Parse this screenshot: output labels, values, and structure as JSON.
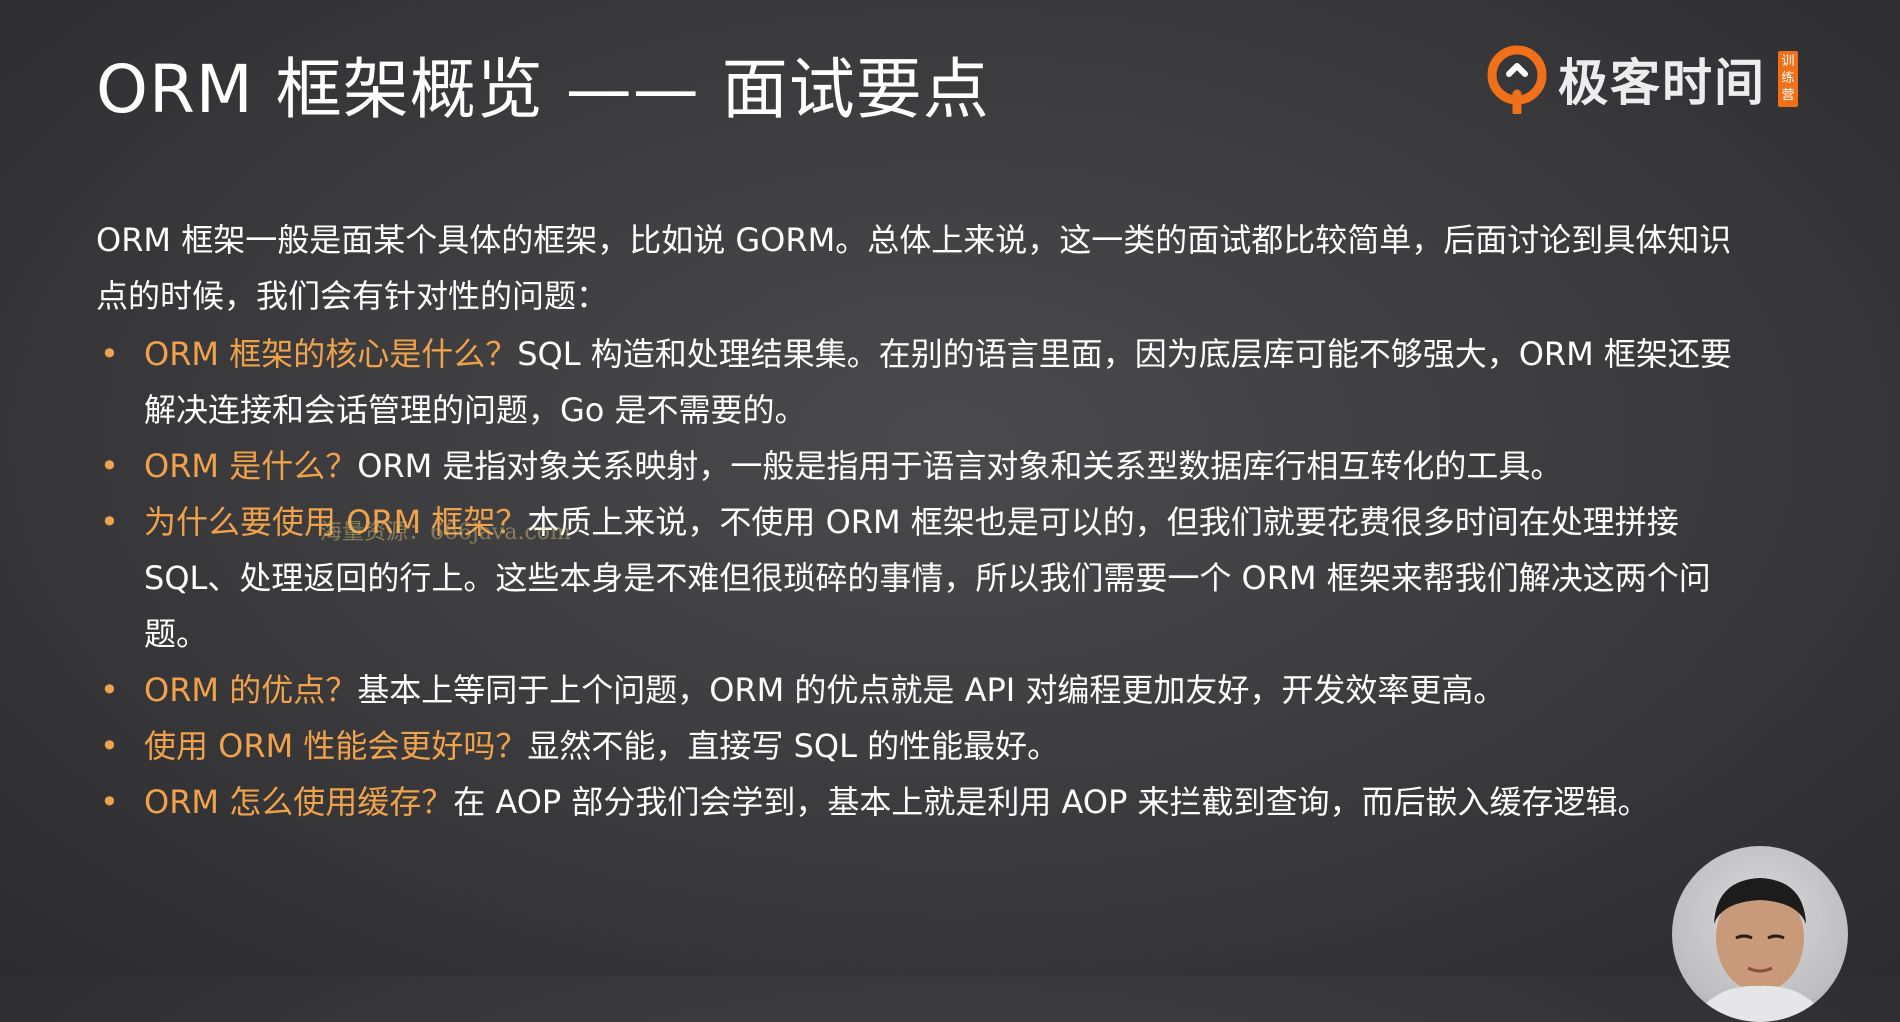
{
  "slide": {
    "title": "ORM 框架概览 —— 面试要点",
    "logo": {
      "brand": "极客时间",
      "badge": "训练营",
      "icon": "geektime-logo-icon"
    },
    "intro": "ORM 框架一般是面某个具体的框架，比如说 GORM。总体上来说，这一类的面试都比较简单，后面讨论到具体知识点的时候，我们会有针对性的问题：",
    "bullets": [
      {
        "question": "ORM 框架的核心是什么？",
        "answer": "SQL 构造和处理结果集。在别的语言里面，因为底层库可能不够强大，ORM 框架还要解决连接和会话管理的问题，Go 是不需要的。"
      },
      {
        "question": "ORM 是什么？",
        "answer": "ORM 是指对象关系映射，一般是指用于语言对象和关系型数据库行相互转化的工具。"
      },
      {
        "question": "为什么要使用 ORM 框架？",
        "answer": "本质上来说，不使用 ORM 框架也是可以的，但我们就要花费很多时间在处理拼接 SQL、处理返回的行上。这些本身是不难但很琐碎的事情，所以我们需要一个 ORM 框架来帮我们解决这两个问题。"
      },
      {
        "question": "ORM 的优点？",
        "answer": "基本上等同于上个问题，ORM 的优点就是 API 对编程更加友好，开发效率更高。"
      },
      {
        "question": "使用 ORM 性能会更好吗？",
        "answer": "显然不能，直接写 SQL 的性能最好。"
      },
      {
        "question": "ORM 怎么使用缓存？",
        "answer": "在 AOP 部分我们会学到，基本上就是利用 AOP 来拦截到查询，而后嵌入缓存逻辑。"
      }
    ],
    "bullet_marker": "•",
    "watermark": "海量资源：666java.com"
  },
  "colors": {
    "accent": "#f0a24b",
    "logo_orange": "#f0701a",
    "text": "#ffffff"
  }
}
